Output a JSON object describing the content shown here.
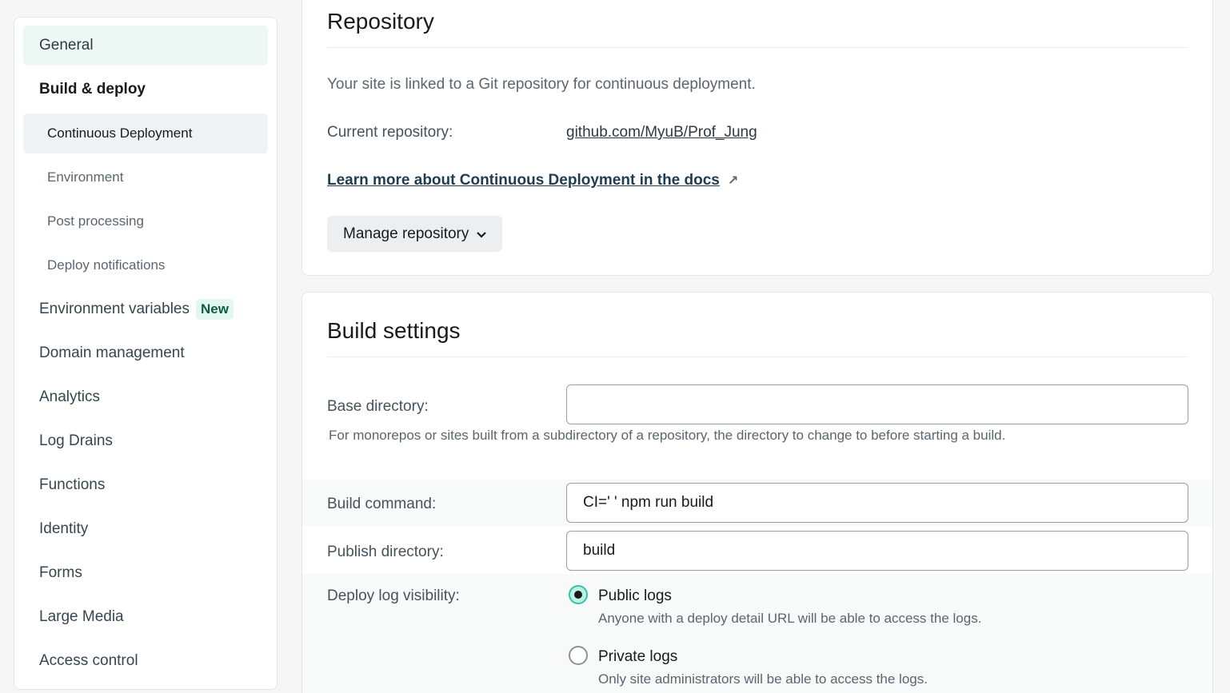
{
  "sidebar": {
    "items": [
      {
        "label": "General"
      },
      {
        "label": "Build & deploy"
      },
      {
        "label": "Continuous Deployment"
      },
      {
        "label": "Environment"
      },
      {
        "label": "Post processing"
      },
      {
        "label": "Deploy notifications"
      },
      {
        "label": "Environment variables",
        "badge": "New"
      },
      {
        "label": "Domain management"
      },
      {
        "label": "Analytics"
      },
      {
        "label": "Log Drains"
      },
      {
        "label": "Functions"
      },
      {
        "label": "Identity"
      },
      {
        "label": "Forms"
      },
      {
        "label": "Large Media"
      },
      {
        "label": "Access control"
      }
    ]
  },
  "repository": {
    "title": "Repository",
    "description": "Your site is linked to a Git repository for continuous deployment.",
    "current_label": "Current repository:",
    "current_value": "github.com/MyuB/Prof_Jung",
    "docs_link": "Learn more about Continuous Deployment in the docs",
    "docs_icon": "↗",
    "manage_button": "Manage repository",
    "manage_chevron": "⌄"
  },
  "build_settings": {
    "title": "Build settings",
    "base_directory": {
      "label": "Base directory:",
      "value": "",
      "help": "For monorepos or sites built from a subdirectory of a repository, the directory to change to before starting a build."
    },
    "build_command": {
      "label": "Build command:",
      "value": "CI=' ' npm run build"
    },
    "publish_directory": {
      "label": "Publish directory:",
      "value": "build"
    },
    "deploy_log_visibility": {
      "label": "Deploy log visibility:",
      "options": [
        {
          "label": "Public logs",
          "help": "Anyone with a deploy detail URL will be able to access the logs.",
          "checked": true
        },
        {
          "label": "Private logs",
          "help": "Only site administrators will be able to access the logs.",
          "checked": false
        }
      ]
    }
  },
  "colors": {
    "accent": "#2ec4a6",
    "link": "#1f3d51"
  }
}
